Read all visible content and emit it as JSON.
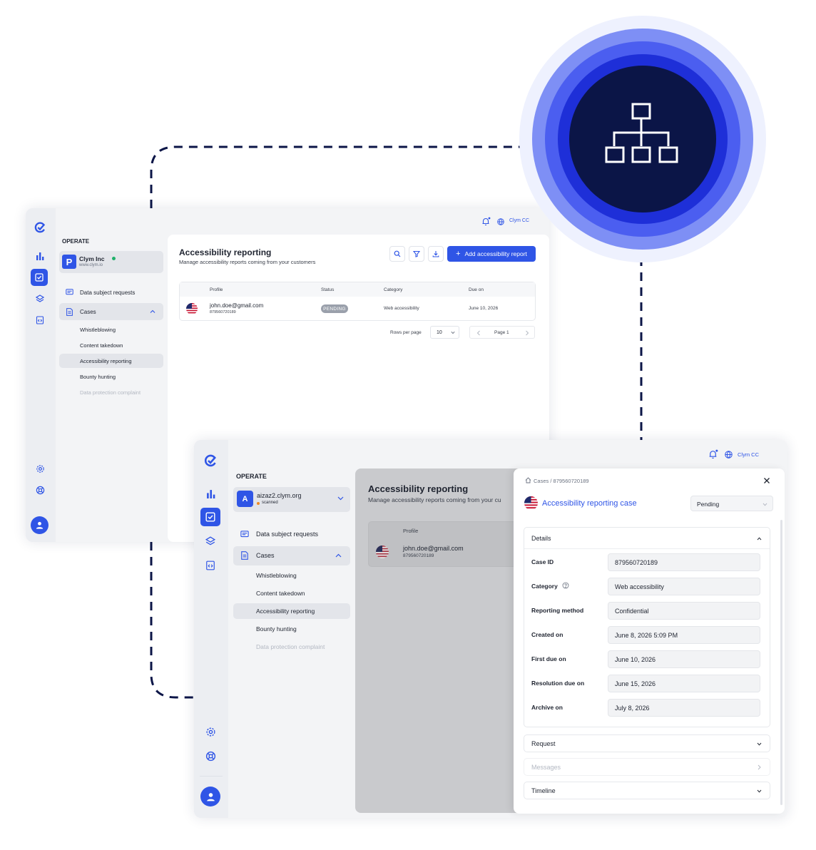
{
  "colors": {
    "accent": "#2f55e6",
    "navy": "#0b1547",
    "ring_light": "#7e8ff5",
    "ring_mid": "#4b5ef0",
    "ring_deep": "#1e2fd8",
    "pending_badge": "#9aa0ab",
    "online_dot": "#1fb06a",
    "scanned_dot": "#f08a24"
  },
  "icons": {
    "hierarchy": "sitemap-icon",
    "logo": "clym-logo-icon",
    "nav": [
      "bar-chart-icon",
      "checklist-icon",
      "layers-icon",
      "code-file-icon"
    ],
    "bottom": [
      "settings-icon",
      "lifebuoy-icon",
      "user-avatar-icon"
    ]
  },
  "topbar": {
    "org_label": "Clym CC"
  },
  "back": {
    "sidebar": {
      "section": "OPERATE",
      "company": {
        "initial": "P",
        "name": "Clym Inc",
        "url": "www.clym.io"
      },
      "items": {
        "dsr": "Data subject requests",
        "cases": "Cases"
      },
      "subitems": {
        "whistle": "Whistleblowing",
        "takedown": "Content takedown",
        "access": "Accessibility reporting",
        "bounty": "Bounty hunting",
        "dpc": "Data protection complaint"
      }
    },
    "main": {
      "title": "Accessibility reporting",
      "subtitle": "Manage accessibility reports coming from your customers",
      "add_button": "Add accessibility report",
      "table": {
        "headers": {
          "profile": "Profile",
          "status": "Status",
          "category": "Category",
          "due": "Due on"
        },
        "row": {
          "email": "john.doe@gmail.com",
          "id": "879560720189",
          "status": "PENDING",
          "category": "Web accessibility",
          "due": "June 10, 2026"
        }
      },
      "pagination": {
        "rows_label": "Rows per page",
        "rows_value": "10",
        "page_label": "Page 1"
      }
    }
  },
  "front": {
    "sidebar": {
      "section": "OPERATE",
      "company": {
        "initial": "A",
        "name": "aizaz2.clym.org",
        "status": "scanned"
      },
      "items": {
        "dsr": "Data subject requests",
        "cases": "Cases"
      },
      "subitems": {
        "whistle": "Whistleblowing",
        "takedown": "Content takedown",
        "access": "Accessibility reporting",
        "bounty": "Bounty hunting",
        "dpc": "Data protection complaint"
      }
    },
    "main": {
      "title": "Accessibility reporting",
      "subtitle": "Manage accessibility reports coming from your cu",
      "profile_header": "Profile",
      "email": "john.doe@gmail.com",
      "id": "879560720189"
    },
    "panel": {
      "breadcrumb": {
        "root": "Cases",
        "sep": "/",
        "current": "879560720189"
      },
      "title": "Accessibility reporting case",
      "status_value": "Pending",
      "details_label": "Details",
      "fields": {
        "case_id": {
          "label": "Case ID",
          "value": "879560720189"
        },
        "category": {
          "label": "Category",
          "value": "Web accessibility"
        },
        "method": {
          "label": "Reporting method",
          "value": "Confidential"
        },
        "created": {
          "label": "Created on",
          "value": "June 8, 2026 5:09 PM"
        },
        "first_due": {
          "label": "First due on",
          "value": "June 10, 2026"
        },
        "resolution": {
          "label": "Resolution due on",
          "value": "June 15, 2026"
        },
        "archive": {
          "label": "Archive on",
          "value": "July 8, 2026"
        }
      },
      "sections": {
        "request": "Request",
        "messages": "Messages",
        "timeline": "Timeline"
      }
    }
  }
}
